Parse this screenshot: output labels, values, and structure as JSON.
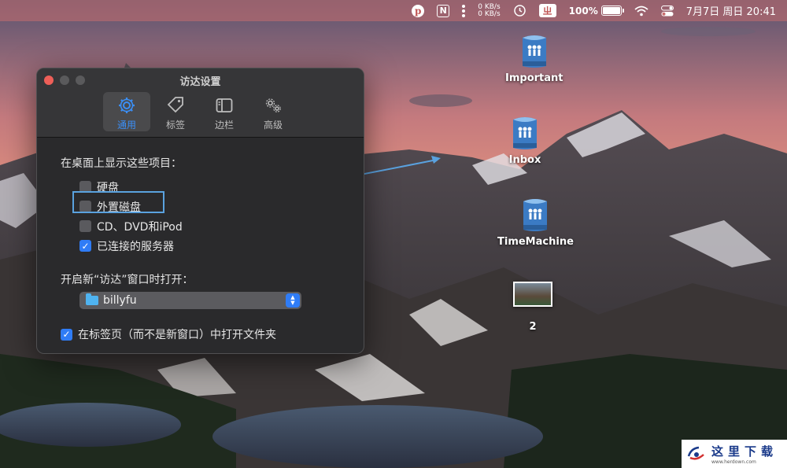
{
  "menubar": {
    "pinterest_icon": "pinterest-icon",
    "notion_glyph": "N",
    "net_up": "0 KB/s",
    "net_down": "0 KB/s",
    "ime_glyph": "ㄓ",
    "battery_text": "100%",
    "battery_level": 1.0,
    "clock": "7月7日 周日  20:41"
  },
  "window": {
    "title": "访达设置",
    "tabs": [
      {
        "label": "通用",
        "icon": "gear-icon",
        "active": true
      },
      {
        "label": "标签",
        "icon": "tag-icon",
        "active": false
      },
      {
        "label": "边栏",
        "icon": "sidebar-icon",
        "active": false
      },
      {
        "label": "高级",
        "icon": "gears-icon",
        "active": false
      }
    ],
    "show_on_desktop_label": "在桌面上显示这些项目：",
    "desktop_items": [
      {
        "label": "硬盘",
        "checked": false
      },
      {
        "label": "外置磁盘",
        "checked": false
      },
      {
        "label": "CD、DVD和iPod",
        "checked": false
      },
      {
        "label": "已连接的服务器",
        "checked": true
      }
    ],
    "new_window_label": "开启新“访达”窗口时打开：",
    "new_window_value": "billyfu",
    "open_in_tabs_label": "在标签页（而不是新窗口）中打开文件夹",
    "open_in_tabs_checked": true
  },
  "desktop": {
    "icons": [
      {
        "label": "Important",
        "icon": "server-volume-icon"
      },
      {
        "label": "Inbox",
        "icon": "server-volume-icon"
      },
      {
        "label": "TimeMachine",
        "icon": "server-volume-icon"
      },
      {
        "label": "2",
        "icon": "image-thumbnail-icon"
      }
    ]
  },
  "watermark": {
    "cn": "这里下载",
    "en": "www.herdown.com"
  },
  "colors": {
    "accent": "#2f7cf6",
    "highlight_box": "#5aa2df",
    "menubar_tint": "#c86e6e"
  }
}
